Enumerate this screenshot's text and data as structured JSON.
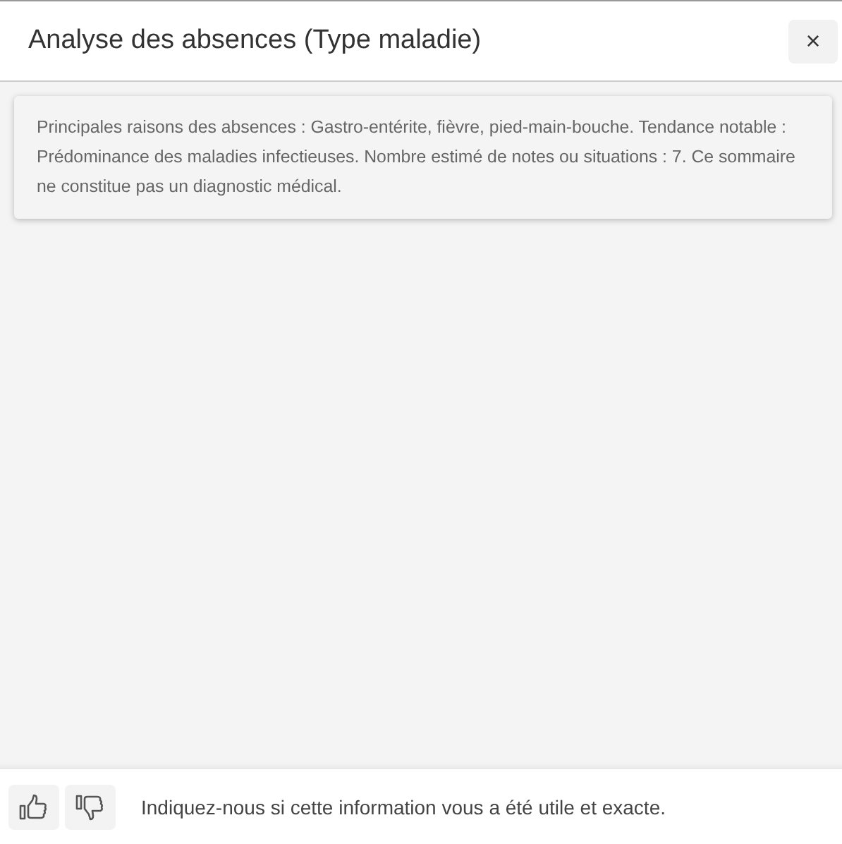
{
  "dialog": {
    "title": "Analyse des absences (Type maladie)",
    "close": "×"
  },
  "summary": {
    "text": "Principales raisons des absences : Gastro-entérite, fièvre, pied-main-bouche. Tendance notable : Prédominance des maladies infectieuses. Nombre estimé de notes ou situations : 7. Ce sommaire ne constitue pas un diagnostic médical."
  },
  "feedback": {
    "prompt": "Indiquez-nous si cette information vous a été utile et exacte."
  }
}
